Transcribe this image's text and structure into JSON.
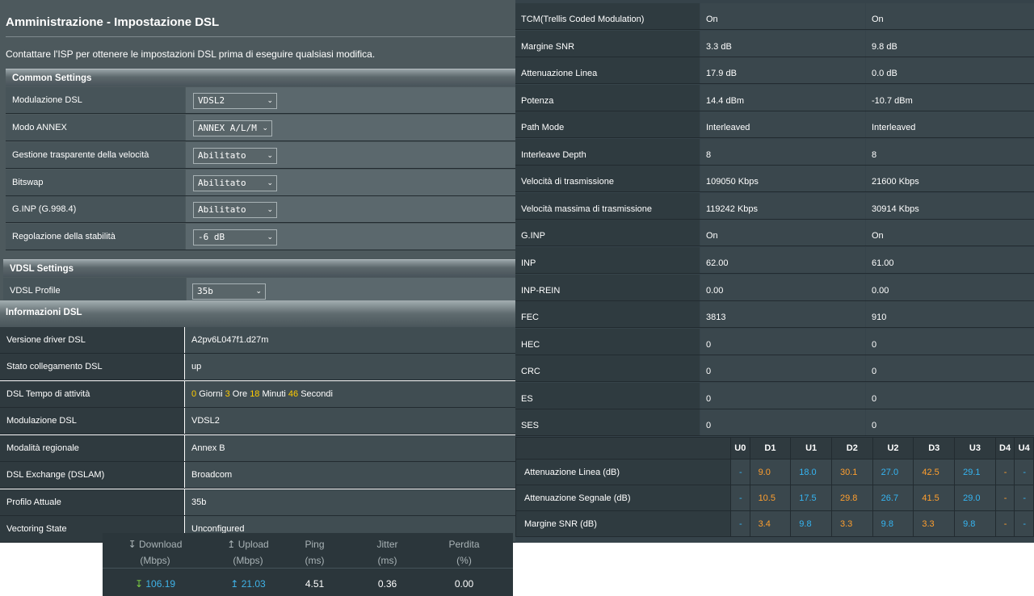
{
  "title": "Amministrazione - Impostazione DSL",
  "note": "Contattare l'ISP per ottenere le impostazioni DSL prima di eseguire qualsiasi modifica.",
  "common": {
    "header": "Common Settings",
    "rows": [
      {
        "label": "Modulazione DSL",
        "value": "VDSL2"
      },
      {
        "label": "Modo ANNEX",
        "value": "ANNEX A/L/M"
      },
      {
        "label": "Gestione trasparente della velocità",
        "value": "Abilitato"
      },
      {
        "label": "Bitswap",
        "value": "Abilitato"
      },
      {
        "label": "G.INP (G.998.4)",
        "value": "Abilitato"
      },
      {
        "label": "Regolazione della stabilità",
        "value": "-6 dB"
      }
    ]
  },
  "vdsl": {
    "header": "VDSL Settings",
    "profile_label": "VDSL Profile",
    "profile_value": "35b"
  },
  "info": {
    "header": "Informazioni DSL",
    "rows": [
      {
        "label": "Versione driver DSL",
        "value": "A2pv6L047f1.d27m"
      },
      {
        "label": "Stato collegamento DSL",
        "value": "up"
      },
      {
        "label": "DSL Tempo di attività",
        "value": ""
      },
      {
        "label": "Modulazione DSL",
        "value": "VDSL2"
      },
      {
        "label": "Modalità regionale",
        "value": "Annex B"
      },
      {
        "label": "DSL Exchange (DSLAM)",
        "value": "Broadcom"
      },
      {
        "label": "Profilo Attuale",
        "value": "35b"
      },
      {
        "label": "Vectoring State",
        "value": "Unconfigured"
      }
    ],
    "uptime": {
      "days": "0",
      "days_label": "Giorni",
      "hours": "3",
      "hours_label": "Ore",
      "minutes": "18",
      "minutes_label": "Minuti",
      "seconds": "46",
      "seconds_label": "Secondi"
    }
  },
  "stats": [
    {
      "label": "TCM(Trellis Coded Modulation)",
      "down": "On",
      "up": "On"
    },
    {
      "label": "Margine SNR",
      "down": "3.3 dB",
      "up": "9.8 dB"
    },
    {
      "label": "Attenuazione Linea",
      "down": "17.9 dB",
      "up": "0.0 dB"
    },
    {
      "label": "Potenza",
      "down": "14.4 dBm",
      "up": "-10.7 dBm"
    },
    {
      "label": "Path Mode",
      "down": "Interleaved",
      "up": "Interleaved"
    },
    {
      "label": "Interleave Depth",
      "down": "8",
      "up": "8"
    },
    {
      "label": "Velocità di trasmissione",
      "down": "109050 Kbps",
      "up": "21600 Kbps"
    },
    {
      "label": "Velocità massima di trasmissione",
      "down": "119242 Kbps",
      "up": "30914 Kbps"
    },
    {
      "label": "G.INP",
      "down": "On",
      "up": "On"
    },
    {
      "label": "INP",
      "down": "62.00",
      "up": "61.00"
    },
    {
      "label": "INP-REIN",
      "down": "0.00",
      "up": "0.00"
    },
    {
      "label": "FEC",
      "down": "3813",
      "up": "910"
    },
    {
      "label": "HEC",
      "down": "0",
      "up": "0"
    },
    {
      "label": "CRC",
      "down": "0",
      "up": "0"
    },
    {
      "label": "ES",
      "down": "0",
      "up": "0"
    },
    {
      "label": "SES",
      "down": "0",
      "up": "0"
    }
  ],
  "bands": {
    "headers": [
      "U0",
      "D1",
      "U1",
      "D2",
      "U2",
      "D3",
      "U3",
      "D4",
      "U4"
    ],
    "rows": [
      {
        "label": "Attenuazione Linea (dB)",
        "values": [
          "-",
          "9.0",
          "18.0",
          "30.1",
          "27.0",
          "42.5",
          "29.1",
          "-",
          "-"
        ]
      },
      {
        "label": "Attenuazione Segnale (dB)",
        "values": [
          "-",
          "10.5",
          "17.5",
          "29.8",
          "26.7",
          "41.5",
          "29.0",
          "-",
          "-"
        ]
      },
      {
        "label": "Margine SNR (dB)",
        "values": [
          "-",
          "3.4",
          "9.8",
          "3.3",
          "9.8",
          "3.3",
          "9.8",
          "-",
          "-"
        ]
      }
    ],
    "colors": {
      "downstream": "#ff9f2e",
      "upstream": "#35b5f2"
    }
  },
  "speedtest": {
    "download_label": "Download",
    "download_unit": "(Mbps)",
    "download": "106.19",
    "upload_label": "Upload",
    "upload_unit": "(Mbps)",
    "upload": "21.03",
    "ping_label": "Ping",
    "ping_unit": "(ms)",
    "ping": "4.51",
    "jitter_label": "Jitter",
    "jitter_unit": "(ms)",
    "jitter": "0.36",
    "loss_label": "Perdita",
    "loss_unit": "(%)",
    "loss": "0.00"
  }
}
